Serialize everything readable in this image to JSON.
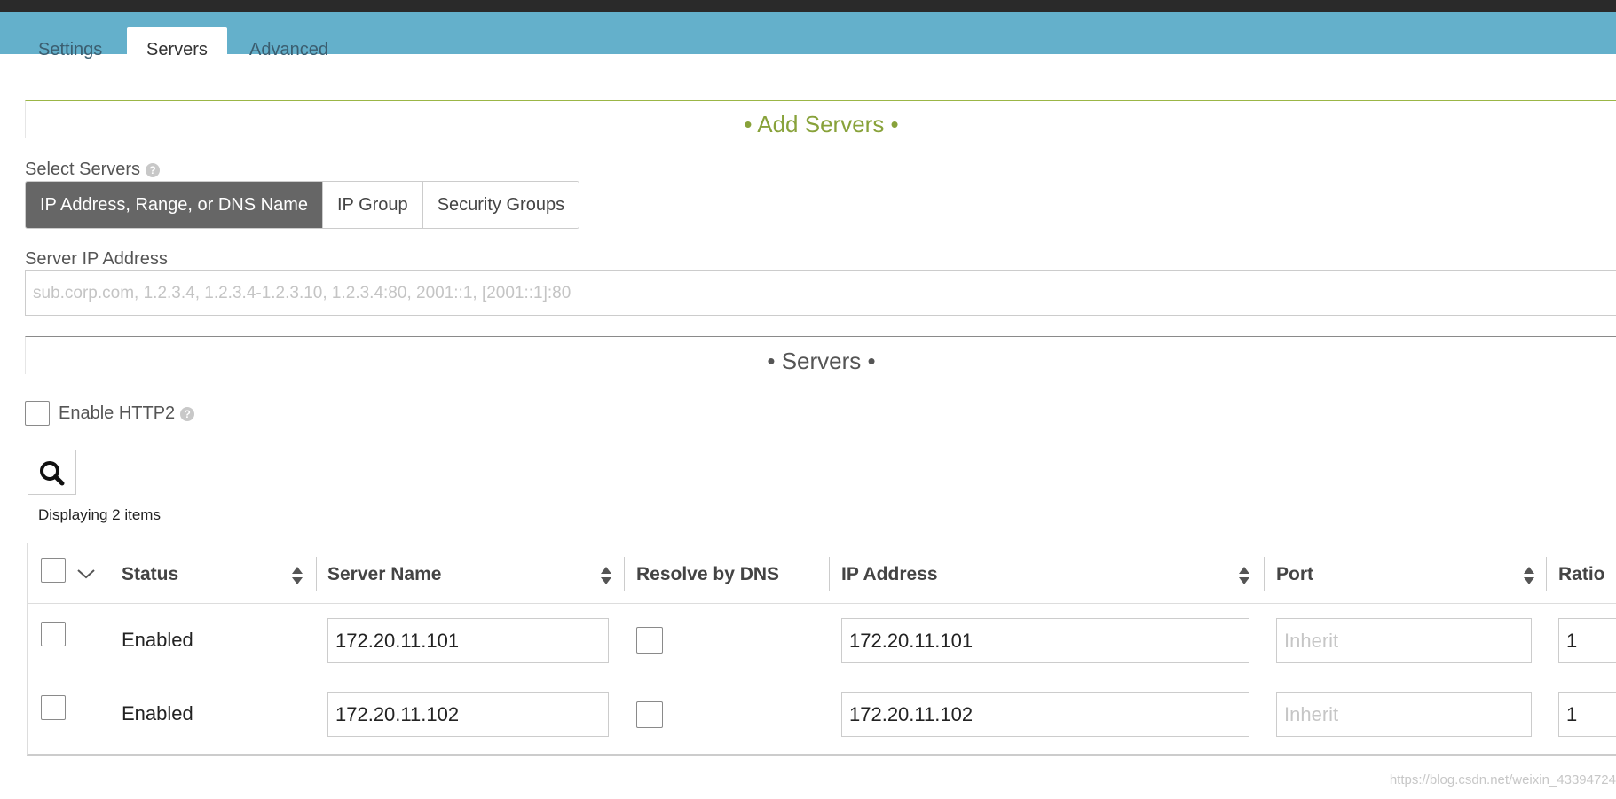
{
  "tabs": [
    {
      "label": "Settings"
    },
    {
      "label": "Servers",
      "active": true
    },
    {
      "label": "Advanced"
    }
  ],
  "add_servers": {
    "title": "• Add Servers •",
    "title_color": "#88a23a",
    "select_label": "Select Servers",
    "help_glyph": "?",
    "segments": [
      "IP Address, Range, or DNS Name",
      "IP Group",
      "Security Groups"
    ],
    "active_segment": "IP Address, Range, or DNS Name",
    "ip_label": "Server IP Address",
    "ip_placeholder": "sub.corp.com, 1.2.3.4, 1.2.3.4-1.2.3.10, 1.2.3.4:80, 2001::1, [2001::1]:80",
    "ip_value": ""
  },
  "servers": {
    "title": "• Servers •",
    "enable_http2_label": "Enable HTTP2",
    "enable_http2_checked": false,
    "search_icon": "search-icon",
    "item_count_text": "Displaying 2 items",
    "columns": [
      "Status",
      "Server Name",
      "Resolve by DNS",
      "IP Address",
      "Port",
      "Ratio"
    ],
    "rows": [
      {
        "status": "Enabled",
        "server_name": "172.20.11.101",
        "resolve_dns": false,
        "ip": "172.20.11.101",
        "port_value": "",
        "port_placeholder": "Inherit",
        "ratio": "1"
      },
      {
        "status": "Enabled",
        "server_name": "172.20.11.102",
        "resolve_dns": false,
        "ip": "172.20.11.102",
        "port_value": "",
        "port_placeholder": "Inherit",
        "ratio": "1"
      }
    ]
  },
  "watermark": "https://blog.csdn.net/weixin_43394724",
  "colors": {
    "tabbar": "#64b0cb",
    "topbar": "#2a2a2a",
    "active_segment": "#666666",
    "servers_title": "#555555"
  }
}
